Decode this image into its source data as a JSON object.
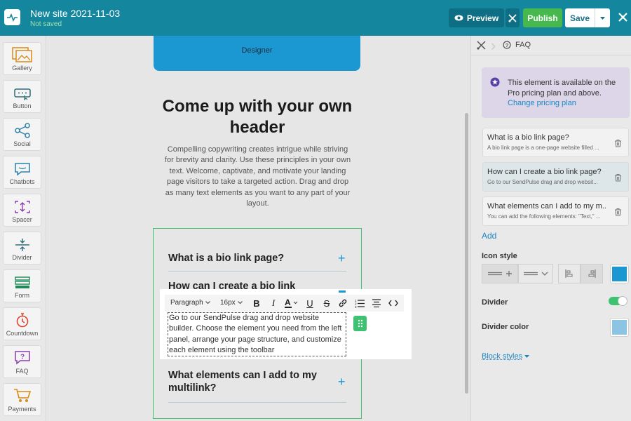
{
  "header": {
    "site_title": "New site 2021-11-03",
    "status": "Not saved",
    "preview_label": "Preview",
    "publish_label": "Publish",
    "save_label": "Save"
  },
  "sidebar": {
    "items": [
      {
        "label": "Gallery",
        "icon": "gallery-icon"
      },
      {
        "label": "Button",
        "icon": "button-icon"
      },
      {
        "label": "Social",
        "icon": "share-icon"
      },
      {
        "label": "Chatbots",
        "icon": "chat-icon"
      },
      {
        "label": "Spacer",
        "icon": "spacer-icon"
      },
      {
        "label": "Divider",
        "icon": "divider-icon"
      },
      {
        "label": "Form",
        "icon": "form-icon"
      },
      {
        "label": "Countdown",
        "icon": "stopwatch-icon"
      },
      {
        "label": "FAQ",
        "icon": "faq-icon"
      },
      {
        "label": "Payments",
        "icon": "cart-icon"
      }
    ]
  },
  "canvas": {
    "designer_label": "Designer",
    "heading": "Come up with your own header",
    "body": "Compelling copywriting creates intrigue while striving for brevity and clarity. Use these principles in your own text. Welcome, captivate, and motivate your landing page visitors to take a targeted action. Drag and drop as many text elements as you want to any part of your layout.",
    "faq": [
      {
        "question": "What is a bio link page?"
      },
      {
        "question": "How can I create a bio link"
      },
      {
        "question": "What elements can I add to my multilink?"
      }
    ],
    "editor": {
      "paragraph_label": "Paragraph",
      "font_size": "16px",
      "text": "Go to our SendPulse drag and drop website builder. Choose the element you need from the left panel, arrange your page structure, and customize each element using the toolbar"
    }
  },
  "right_panel": {
    "breadcrumb": "FAQ",
    "pro_notice": "This element is available on the Pro pricing plan and above.",
    "pro_link": "Change pricing plan",
    "faq_items": [
      {
        "title": "What is a bio link page?",
        "subtitle": "A bio link page is a one-page website filled ..."
      },
      {
        "title": "How can I create a bio link page?",
        "subtitle": "Go to our SendPulse drag and drop websit..."
      },
      {
        "title": "What elements can I add to my m...",
        "subtitle": "You can add the following elements: \"Text,\" ..."
      }
    ],
    "add_label": "Add",
    "icon_style_label": "Icon style",
    "divider_label": "Divider",
    "divider_color_label": "Divider color",
    "block_styles_label": "Block styles",
    "icon_color": "#1b97d2",
    "divider_color": "#8cc4e3"
  }
}
